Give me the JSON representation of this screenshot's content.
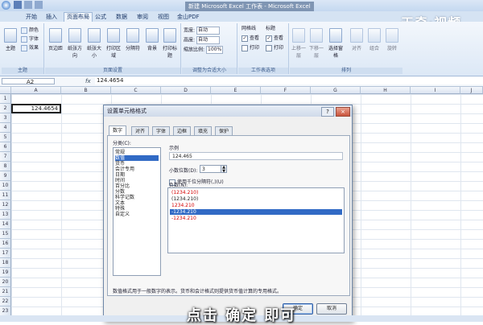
{
  "window": {
    "title": "新建 Microsoft Excel 工作表 - Microsoft Excel"
  },
  "ribbon_tabs": [
    "开始",
    "插入",
    "页面布局",
    "公式",
    "数据",
    "审阅",
    "视图",
    "金山PDF"
  ],
  "ribbon": {
    "theme_group": {
      "label": "主题",
      "big": "主题",
      "items": [
        "颜色",
        "字体",
        "效果"
      ]
    },
    "page_setup_group": {
      "label": "页面设置",
      "buttons": [
        "页边距",
        "纸张方向",
        "纸张大小",
        "打印区域",
        "分隔符",
        "背景",
        "打印标题"
      ]
    },
    "scale_group": {
      "label": "调整为合适大小",
      "width_label": "宽度:",
      "width_value": "自动",
      "height_label": "高度:",
      "height_value": "自动",
      "scale_label": "缩放比例:",
      "scale_value": "100%"
    },
    "sheet_options_group": {
      "label": "工作表选项",
      "gridlines": "网格线",
      "headings": "标题",
      "view": "查看",
      "print": "打印"
    },
    "arrange_group": {
      "label": "排列",
      "buttons": [
        "上移一层",
        "下移一层",
        "选择窗格",
        "对齐",
        "组合",
        "旋转"
      ]
    }
  },
  "formula_bar": {
    "name_box": "A2",
    "fx": "fx",
    "value": "124.4654"
  },
  "columns": [
    "A",
    "B",
    "C",
    "D",
    "E",
    "F",
    "G",
    "H",
    "I",
    "J"
  ],
  "rows": [
    "1",
    "2",
    "3",
    "4",
    "5",
    "6",
    "7",
    "8",
    "9",
    "10",
    "11",
    "12",
    "13",
    "14",
    "15",
    "16",
    "17",
    "18",
    "19",
    "20",
    "21",
    "22",
    "23"
  ],
  "cell_a2": "124.4654",
  "dialog": {
    "title": "设置单元格格式",
    "help": "?",
    "close": "×",
    "tabs": [
      "数字",
      "对齐",
      "字体",
      "边框",
      "填充",
      "保护"
    ],
    "category_label": "分类(C):",
    "categories": [
      "常规",
      "数值",
      "货币",
      "会计专用",
      "日期",
      "时间",
      "百分比",
      "分数",
      "科学记数",
      "文本",
      "特殊",
      "自定义"
    ],
    "selected_category": "数值",
    "sample_label": "示例",
    "sample_value": "124.465",
    "decimal_label": "小数位数(D):",
    "decimal_value": "3",
    "thousands_label": "使用千位分隔符(,)(U)",
    "negative_label": "负数(N):",
    "negative_items": [
      {
        "text": "(1234.210)",
        "red": true
      },
      {
        "text": "(1234.210)",
        "red": false
      },
      {
        "text": "1234.210",
        "red": true
      },
      {
        "text": "-1234.210",
        "red": false,
        "selected": true
      },
      {
        "text": "-1234.210",
        "red": true
      }
    ],
    "description": "数值格式用于一般数字的表示。货币和会计格式则提供货币值计算的专用格式。",
    "ok": "确定",
    "cancel": "取消"
  },
  "subtitle": "点击 确定 即可",
  "watermark": "天奇·视频"
}
